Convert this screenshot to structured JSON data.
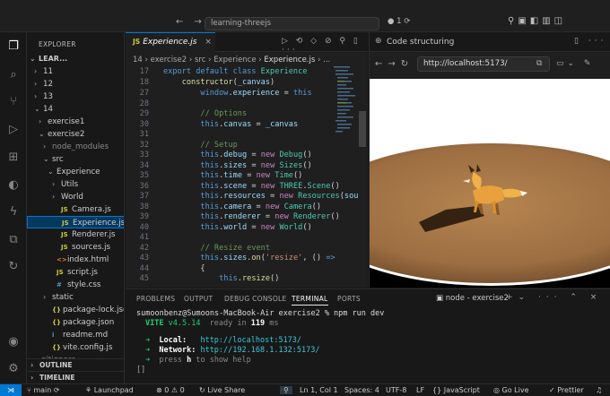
{
  "titlebar": {
    "search": "learning-threejs",
    "git_count": "1",
    "nav_back": "←",
    "nav_fwd": "→"
  },
  "explorer": {
    "title": "EXPLORER",
    "root": "LEAR...",
    "items": [
      {
        "label": "11",
        "depth": 1,
        "chev": "›",
        "icon": ""
      },
      {
        "label": "12",
        "depth": 1,
        "chev": "›",
        "icon": ""
      },
      {
        "label": "13",
        "depth": 1,
        "chev": "›",
        "icon": ""
      },
      {
        "label": "14",
        "depth": 1,
        "chev": "⌄",
        "icon": ""
      },
      {
        "label": "exercise1",
        "depth": 2,
        "chev": "›",
        "icon": ""
      },
      {
        "label": "exercise2",
        "depth": 2,
        "chev": "⌄",
        "icon": ""
      },
      {
        "label": "node_modules",
        "depth": 3,
        "chev": "›",
        "icon": "",
        "dim": true
      },
      {
        "label": "src",
        "depth": 3,
        "chev": "⌄",
        "icon": ""
      },
      {
        "label": "Experience",
        "depth": 4,
        "chev": "⌄",
        "icon": ""
      },
      {
        "label": "Utils",
        "depth": 5,
        "chev": "›",
        "icon": ""
      },
      {
        "label": "World",
        "depth": 5,
        "chev": "›",
        "icon": ""
      },
      {
        "label": "Camera.js",
        "depth": 5,
        "chev": "",
        "icon": "JS"
      },
      {
        "label": "Experience.js",
        "depth": 5,
        "chev": "",
        "icon": "JS",
        "selected": true
      },
      {
        "label": "Renderer.js",
        "depth": 5,
        "chev": "",
        "icon": "JS"
      },
      {
        "label": "sources.js",
        "depth": 5,
        "chev": "",
        "icon": "JS"
      },
      {
        "label": "index.html",
        "depth": 4,
        "chev": "",
        "icon": "<>"
      },
      {
        "label": "script.js",
        "depth": 4,
        "chev": "",
        "icon": "JS"
      },
      {
        "label": "style.css",
        "depth": 4,
        "chev": "",
        "icon": "#"
      },
      {
        "label": "static",
        "depth": 3,
        "chev": "›",
        "icon": ""
      },
      {
        "label": "package-lock.json",
        "depth": 3,
        "chev": "",
        "icon": "{}"
      },
      {
        "label": "package.json",
        "depth": 3,
        "chev": "",
        "icon": "{}"
      },
      {
        "label": "readme.md",
        "depth": 3,
        "chev": "",
        "icon": "i"
      },
      {
        "label": "vite.config.js",
        "depth": 3,
        "chev": "",
        "icon": "{}"
      }
    ],
    "outline": "OUTLINE",
    "timeline": "TIMELINE",
    "hidden_row": ".gitignore"
  },
  "editor": {
    "tab": "Experience.js",
    "breadcrumb": [
      "14",
      "exercise2",
      "src",
      "Experience",
      "Experience.js",
      "..."
    ],
    "sticky": [
      {
        "n": "17",
        "html": "<span class='kw'>export default class</span> <span class='cls'>Experience</span>"
      },
      {
        "n": "18",
        "html": "    <span class='fn'>constructor</span><span class='pl'>(</span><span class='id'>_canvas</span><span class='pl'>)</span>"
      }
    ],
    "lines": [
      {
        "n": "27",
        "html": "        <span class='kw'>window</span><span class='pl'>.</span><span class='id'>experience</span> <span class='pl'>=</span> <span class='kw'>this</span>"
      },
      {
        "n": "28",
        "html": ""
      },
      {
        "n": "29",
        "html": "        <span class='cm'>// Options</span>"
      },
      {
        "n": "30",
        "html": "        <span class='kw'>this</span><span class='pl'>.</span><span class='id'>canvas</span> <span class='pl'>=</span> <span class='id'>_canvas</span>"
      },
      {
        "n": "31",
        "html": ""
      },
      {
        "n": "32",
        "html": "        <span class='cm'>// Setup</span>"
      },
      {
        "n": "33",
        "html": "        <span class='kw'>this</span><span class='pl'>.</span><span class='id'>debug</span> <span class='pl'>=</span> <span class='ck'>new</span> <span class='cls'>Debug</span><span class='pl'>()</span>"
      },
      {
        "n": "34",
        "html": "        <span class='kw'>this</span><span class='pl'>.</span><span class='id'>sizes</span> <span class='pl'>=</span> <span class='ck'>new</span> <span class='cls'>Sizes</span><span class='pl'>()</span>"
      },
      {
        "n": "35",
        "html": "        <span class='kw'>this</span><span class='pl'>.</span><span class='id'>time</span> <span class='pl'>=</span> <span class='ck'>new</span> <span class='cls'>Time</span><span class='pl'>()</span>"
      },
      {
        "n": "36",
        "html": "        <span class='kw'>this</span><span class='pl'>.</span><span class='id'>scene</span> <span class='pl'>=</span> <span class='ck'>new</span> <span class='cls'>THREE</span><span class='pl'>.</span><span class='cls'>Scene</span><span class='pl'>()</span>"
      },
      {
        "n": "37",
        "html": "        <span class='kw'>this</span><span class='pl'>.</span><span class='id'>resources</span> <span class='pl'>=</span> <span class='ck'>new</span> <span class='cls'>Resources</span><span class='pl'>(</span><span class='id'>sou</span>"
      },
      {
        "n": "38",
        "html": "        <span class='kw'>this</span><span class='pl'>.</span><span class='id'>camera</span> <span class='pl'>=</span> <span class='ck'>new</span> <span class='cls'>Camera</span><span class='pl'>()</span>"
      },
      {
        "n": "39",
        "html": "        <span class='kw'>this</span><span class='pl'>.</span><span class='id'>renderer</span> <span class='pl'>=</span> <span class='ck'>new</span> <span class='cls'>Renderer</span><span class='pl'>()</span>"
      },
      {
        "n": "40",
        "html": "        <span class='kw'>this</span><span class='pl'>.</span><span class='id'>world</span> <span class='pl'>=</span> <span class='ck'>new</span> <span class='cls'>World</span><span class='pl'>()</span>"
      },
      {
        "n": "41",
        "html": ""
      },
      {
        "n": "42",
        "html": "        <span class='cm'>// Resize event</span>"
      },
      {
        "n": "43",
        "html": "        <span class='kw'>this</span><span class='pl'>.</span><span class='id'>sizes</span><span class='pl'>.</span><span class='fn'>on</span><span class='pl'>(</span><span class='str'>'resize'</span><span class='pl'>, () </span><span class='kw'>=></span>"
      },
      {
        "n": "44",
        "html": "        <span class='pl'>{</span>"
      },
      {
        "n": "45",
        "html": "            <span class='kw'>this</span><span class='pl'>.</span><span class='fn'>resize</span><span class='pl'>()</span>"
      }
    ]
  },
  "panel": {
    "tabs": [
      "PROBLEMS",
      "OUTPUT",
      "DEBUG CONSOLE",
      "TERMINAL",
      "PORTS"
    ],
    "active_tab": "TERMINAL",
    "terminal_name": "node - exercise2",
    "prompt": "sumoonbenz@Sumoons-MacBook-Air exercise2 % npm run dev",
    "vite_name": "VITE",
    "vite_version": "v4.5.14",
    "ready_prefix": "ready in",
    "ready_ms": "119",
    "ready_unit": "ms",
    "local_label": "Local:",
    "local_url": "http://localhost:5173/",
    "network_label": "Network:",
    "network_url": "http://192.168.1.132:5173/",
    "help_prefix": "press",
    "help_key": "h",
    "help_suffix": "to show help",
    "cursor": "[]"
  },
  "browser": {
    "tab_title": "Code structuring",
    "url": "http://localhost:5173/"
  },
  "statusbar": {
    "branch": "main",
    "launchpad": "Launchpad",
    "errors": "0",
    "warnings": "0",
    "live_share": "Live Share",
    "position": "Ln 1, Col 1",
    "spaces": "Spaces: 4",
    "encoding": "UTF-8",
    "eol": "LF",
    "language": "JavaScript",
    "golive": "Go Live",
    "prettier": "Prettier"
  },
  "colors": {
    "accent": "#0078d4",
    "ground": "#a8794a",
    "fox": "#e8a13c"
  }
}
